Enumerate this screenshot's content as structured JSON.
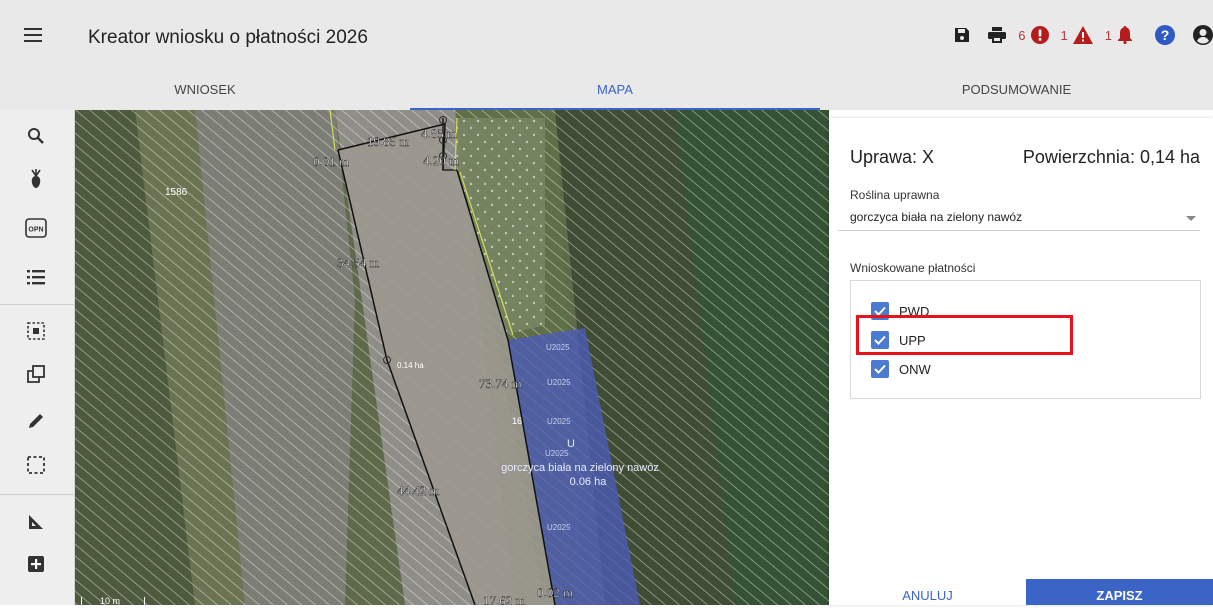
{
  "app": {
    "title": "Kreator wniosku o płatności 2026"
  },
  "toolbar": {
    "icons": [
      "save-icon",
      "print-icon",
      "error-icon",
      "warning-icon",
      "bell-icon",
      "help-icon",
      "account-icon"
    ],
    "error_count": "6",
    "warning_count": "1",
    "notification_count": "1",
    "colors": {
      "error": "#b71c1c",
      "help": "#2f59c4"
    }
  },
  "tabs": [
    {
      "label": "WNIOSEK"
    },
    {
      "label": "MAPA"
    },
    {
      "label": "PODSUMOWANIE"
    }
  ],
  "sidebar": {
    "tools": [
      "search-icon",
      "crop-icon",
      "opn-icon",
      "list-icon",
      "select-region-icon",
      "copy-icon",
      "edit-icon",
      "dashed-select-icon",
      "measure-icon",
      "add-icon"
    ],
    "opn_label": "OPN"
  },
  "map": {
    "labels": {
      "parcel_id": "1586",
      "m1": "19.85 m",
      "m2": "4.85 m",
      "m3": "4.20 m",
      "m4": "0.01 m",
      "m5": "34.54 m",
      "m6": "73.74 m",
      "m7": "44.42 m",
      "m8": "0.02 m",
      "m9": "17.62 m",
      "small_area": "0.14 ha",
      "parcel_16": "16",
      "u2025_a": "U2025",
      "u2025_b": "U2025",
      "u2025_c": "U2025",
      "u2025_d": "U2025",
      "u2025_e": "U2025",
      "plot_u": "U",
      "plot_crop": "gorczyca biała na zielony nawóz",
      "plot_area": "0.06 ha",
      "scale_label": "10 m"
    },
    "colors": {
      "selected_plot": "#4a5bb8",
      "parcel_outline": "#d5dc5a"
    }
  },
  "panel": {
    "crop_title": "Uprawa: X",
    "area_title": "Powierzchnia: 0,14 ha",
    "plant_label": "Roślina uprawna",
    "plant_value": "gorczyca biała na zielony nawóz",
    "payments_label": "Wnioskowane płatności",
    "payments": [
      {
        "code": "PWD",
        "checked": true
      },
      {
        "code": "UPP",
        "checked": true
      },
      {
        "code": "ONW",
        "checked": true
      }
    ],
    "highlighted_payment": "UPP",
    "cancel_label": "ANULUJ",
    "save_label": "ZAPISZ",
    "accent_color": "#3a64c6"
  }
}
